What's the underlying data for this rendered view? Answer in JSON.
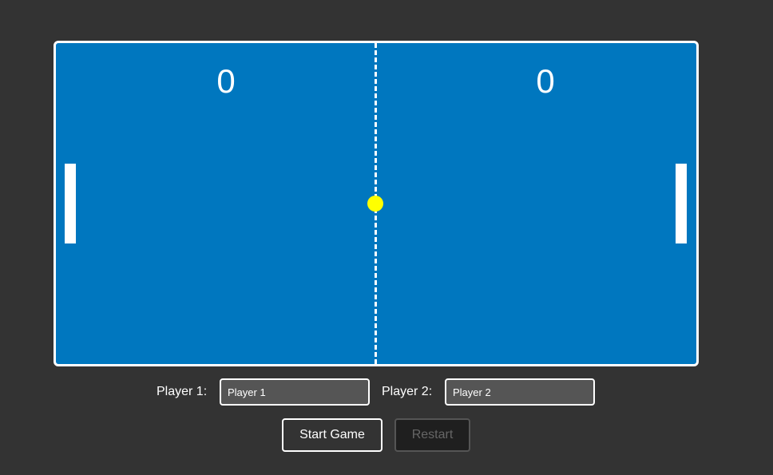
{
  "scoreboard": {
    "left_score": "0",
    "right_score": "0"
  },
  "ball": {
    "color": "#ffff00"
  },
  "colors": {
    "field": "#0077bf",
    "background": "#333333",
    "paddle": "#ffffff"
  },
  "players": {
    "p1_label": "Player 1:",
    "p1_value": "Player 1",
    "p2_label": "Player 2:",
    "p2_value": "Player 2"
  },
  "buttons": {
    "start_label": "Start Game",
    "restart_label": "Restart",
    "restart_disabled": true
  }
}
